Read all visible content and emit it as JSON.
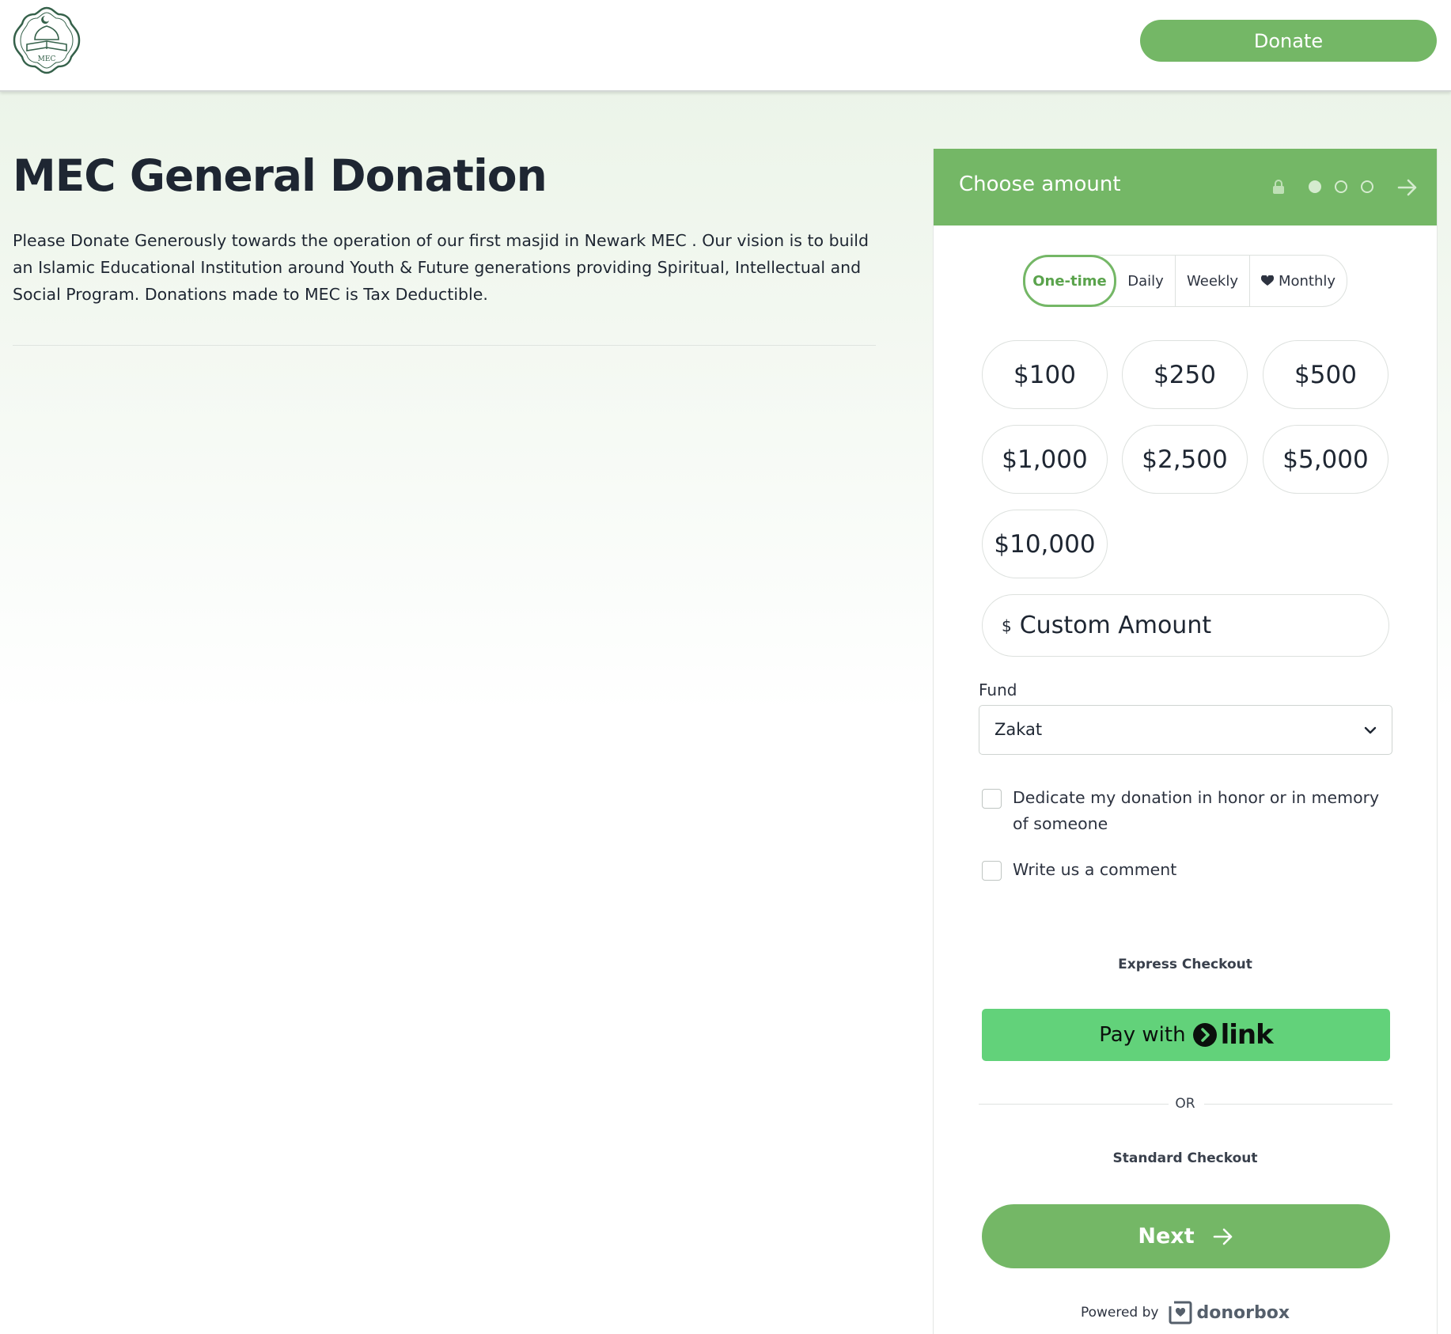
{
  "header": {
    "logo_text": "MEC",
    "donate_label": "Donate"
  },
  "campaign": {
    "title": "MEC General Donation",
    "description": "Please Donate Generously towards the operation of our first masjid in Newark MEC . Our vision is to build an Islamic Educational Institution around Youth & Future generations providing Spiritual, Intellectual and Social Program. Donations made to MEC is Tax Deductible."
  },
  "panel": {
    "title": "Choose amount",
    "current_step": 1,
    "total_steps": 3,
    "frequency_tabs": [
      {
        "label": "One-time",
        "selected": true
      },
      {
        "label": "Daily",
        "selected": false
      },
      {
        "label": "Weekly",
        "selected": false
      },
      {
        "label": "Monthly",
        "selected": false,
        "icon": "heart-icon"
      }
    ],
    "amounts": [
      "$100",
      "$250",
      "$500",
      "$1,000",
      "$2,500",
      "$5,000",
      "$10,000"
    ],
    "custom_amount": {
      "currency_symbol": "$",
      "placeholder": "Custom Amount"
    },
    "fund": {
      "label": "Fund",
      "selected": "Zakat"
    },
    "options": {
      "dedicate_label": "Dedicate my donation in honor or in memory of someone",
      "comment_label": "Write us a comment"
    },
    "express_checkout_label": "Express Checkout",
    "link_button": {
      "prefix": "Pay with",
      "brand": "link"
    },
    "or_label": "OR",
    "standard_checkout_label": "Standard Checkout",
    "next_label": "Next",
    "powered_by": {
      "prefix": "Powered by",
      "brand": "donorbox"
    }
  },
  "colors": {
    "brand_green": "#74b766",
    "link_green": "#62d27a",
    "text_dark": "#1e2632"
  }
}
